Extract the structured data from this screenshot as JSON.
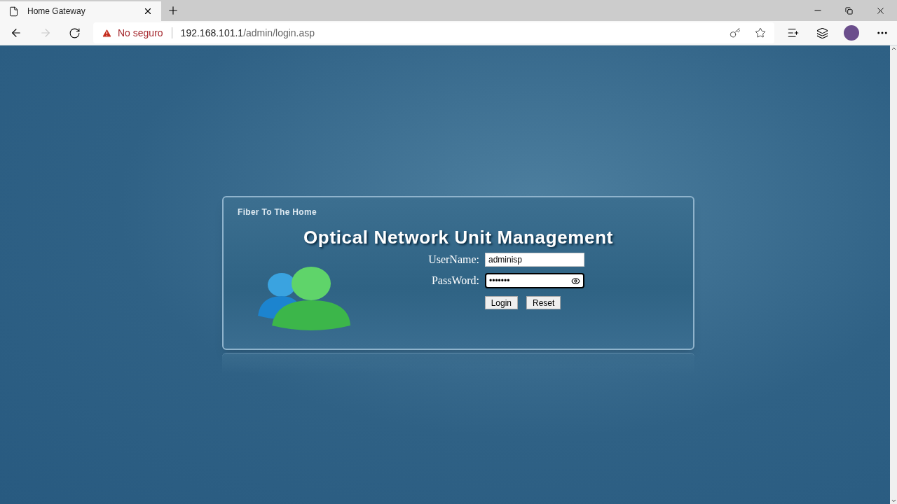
{
  "browser": {
    "tab_title": "Home Gateway",
    "security_label": "No seguro",
    "url_host": "192.168.101.1",
    "url_path": "/admin/login.asp"
  },
  "login": {
    "subtitle": "Fiber To The Home",
    "title": "Optical Network Unit Management",
    "fields": [
      {
        "kind": "text",
        "label": "UserName:",
        "value": "adminisp",
        "focused": false
      },
      {
        "kind": "password",
        "label": "PassWord:",
        "value": "•••••••",
        "focused": true
      }
    ],
    "buttons": [
      "Login",
      "Reset"
    ]
  }
}
